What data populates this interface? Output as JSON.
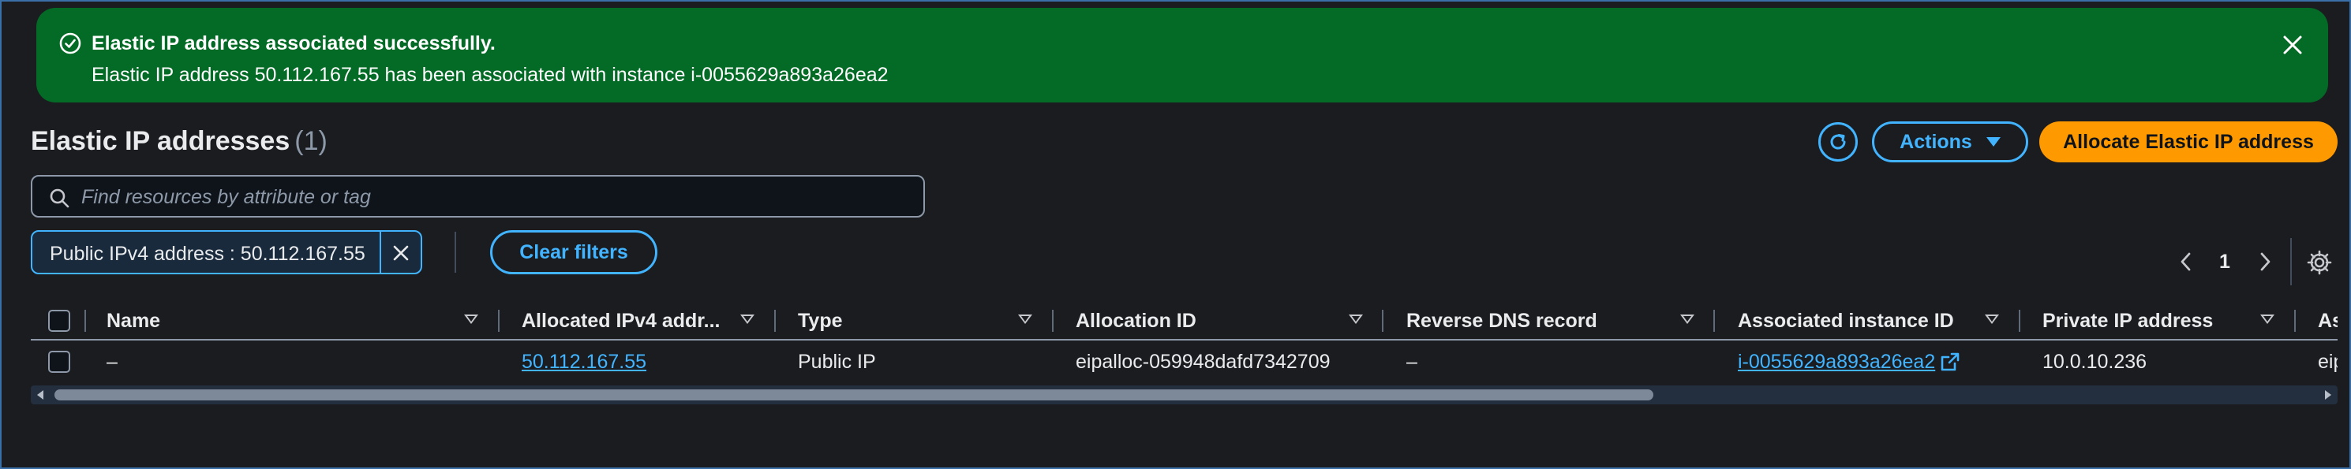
{
  "flash": {
    "title": "Elastic IP address associated successfully.",
    "message": "Elastic IP address 50.112.167.55 has been associated with instance i-0055629a893a26ea2",
    "type": "success",
    "color": "#036b26"
  },
  "header": {
    "title": "Elastic IP addresses",
    "count": "(1)",
    "actions_label": "Actions",
    "allocate_label": "Allocate Elastic IP address"
  },
  "search": {
    "placeholder": "Find resources by attribute or tag",
    "value": ""
  },
  "filters": {
    "token_label": "Public IPv4 address : 50.112.167.55",
    "clear_label": "Clear filters"
  },
  "pagination": {
    "current_page": "1"
  },
  "table": {
    "columns": [
      "Name",
      "Allocated IPv4 addr...",
      "Type",
      "Allocation ID",
      "Reverse DNS record",
      "Associated instance ID",
      "Private IP address",
      "As"
    ],
    "rows": [
      {
        "name": "–",
        "allocated_ipv4": "50.112.167.55",
        "type": "Public IP",
        "allocation_id": "eipalloc-059948dafd7342709",
        "reverse_dns": "–",
        "instance_id": "i-0055629a893a26ea2",
        "private_ip": "10.0.10.236",
        "association": "eip"
      }
    ]
  },
  "colors": {
    "accent": "#42b4ff",
    "primary_button": "#ff9900",
    "background": "#1b1c1f"
  }
}
